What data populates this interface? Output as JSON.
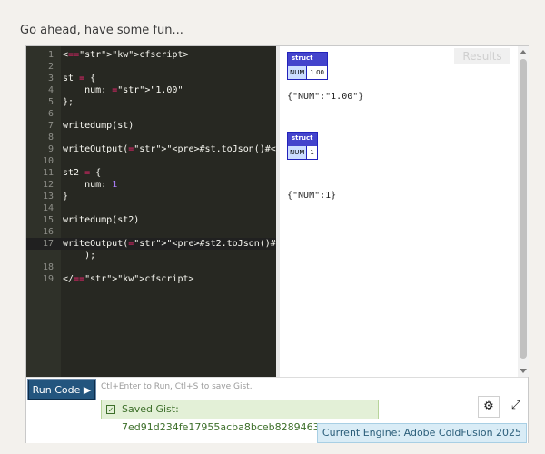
{
  "intro": "Go ahead, have some fun...",
  "editor": {
    "lines": [
      {
        "n": "1",
        "t": "<cfscript>"
      },
      {
        "n": "2",
        "t": ""
      },
      {
        "n": "3",
        "t": "st = {"
      },
      {
        "n": "4",
        "t": "    num: \"1.00\""
      },
      {
        "n": "5",
        "t": "};"
      },
      {
        "n": "6",
        "t": ""
      },
      {
        "n": "7",
        "t": "writedump(st)"
      },
      {
        "n": "8",
        "t": ""
      },
      {
        "n": "9",
        "t": "writeOutput(\"<pre>#st.toJson()#<pre>\");"
      },
      {
        "n": "10",
        "t": ""
      },
      {
        "n": "11",
        "t": "st2 = {"
      },
      {
        "n": "12",
        "t": "    num: 1"
      },
      {
        "n": "13",
        "t": "}"
      },
      {
        "n": "14",
        "t": ""
      },
      {
        "n": "15",
        "t": "writedump(st2)"
      },
      {
        "n": "16",
        "t": ""
      },
      {
        "n": "17",
        "t": "writeOutput(\"<pre>#st2.toJson()#<pre>\""
      },
      {
        "n": "",
        "t": "    );"
      },
      {
        "n": "18",
        "t": ""
      },
      {
        "n": "19",
        "t": "</cfscript>"
      }
    ]
  },
  "results": {
    "label": "Results",
    "dump1": {
      "title": "struct",
      "key": "NUM",
      "value": "1.00"
    },
    "json1": "{\"NUM\":\"1.00\"}",
    "dump2": {
      "title": "struct",
      "key": "NUM",
      "value": "1"
    },
    "json2": "{\"NUM\":1}"
  },
  "toolbar": {
    "run_label": "Run Code ▶",
    "hint": "Ctl+Enter to Run, Ctl+S to save Gist.",
    "gist_text": "Saved Gist: 7ed91d234fe17955acba8bceb8289463",
    "check_glyph": "✓",
    "settings_glyph": "⚙",
    "expand_glyph": "⤢",
    "engine": "Current Engine: Adobe ColdFusion 2025"
  }
}
